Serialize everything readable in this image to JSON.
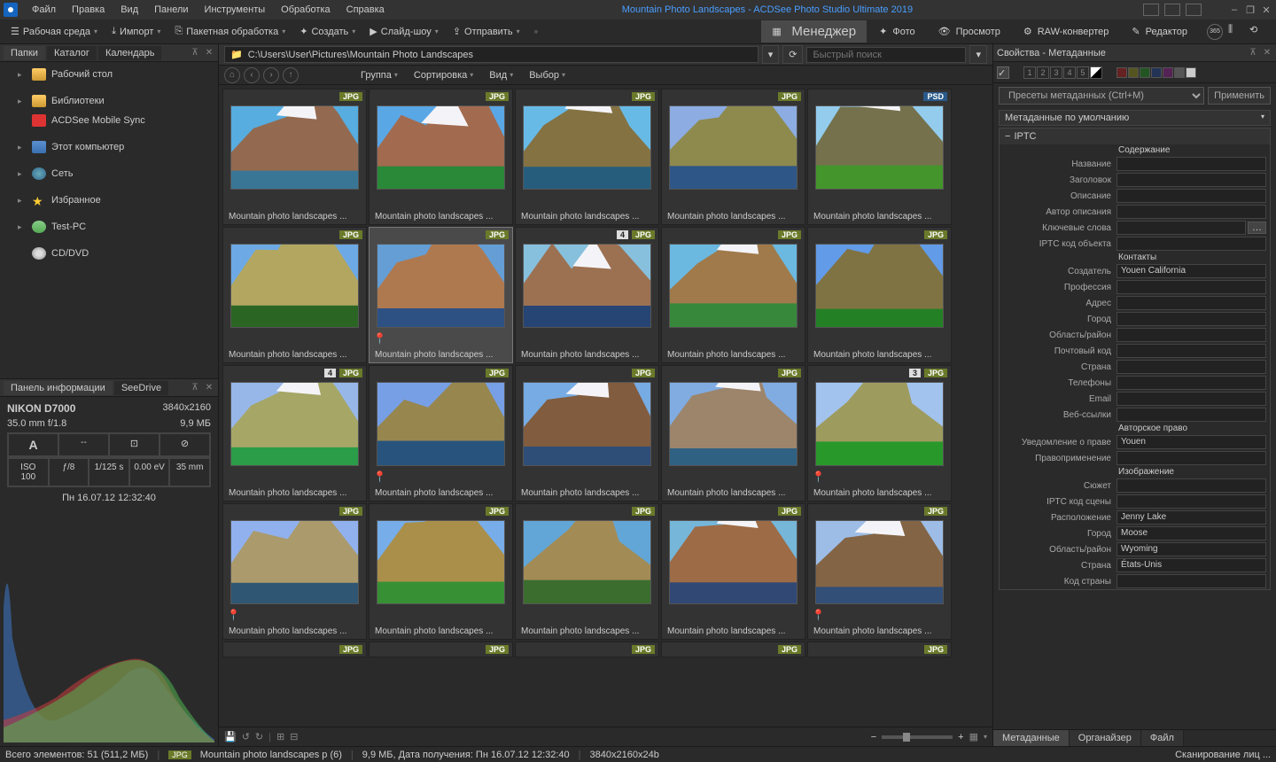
{
  "app": {
    "title": "Mountain Photo Landscapes - ACDSee Photo Studio Ultimate 2019"
  },
  "menu": [
    "Файл",
    "Правка",
    "Вид",
    "Панели",
    "Инструменты",
    "Обработка",
    "Справка"
  ],
  "toolbar": {
    "workspace": "Рабочая среда",
    "import": "Импорт",
    "batch": "Пакетная обработка",
    "create": "Создать",
    "slideshow": "Слайд-шоу",
    "send": "Отправить"
  },
  "modes": {
    "manage": "Менеджер",
    "photo": "Фото",
    "view": "Просмотр",
    "raw": "RAW-конвертер",
    "edit": "Редактор"
  },
  "folders": {
    "tabs": [
      "Папки",
      "Каталог",
      "Календарь"
    ],
    "items": [
      {
        "label": "Рабочий стол",
        "icon": "desktop",
        "exp": true
      },
      {
        "label": "Библиотеки",
        "icon": "lib",
        "exp": true
      },
      {
        "label": "ACDSee Mobile Sync",
        "icon": "mobile",
        "exp": false
      },
      {
        "label": "Этот компьютер",
        "icon": "pc",
        "exp": true
      },
      {
        "label": "Сеть",
        "icon": "net",
        "exp": true
      },
      {
        "label": "Избранное",
        "icon": "star",
        "exp": true
      },
      {
        "label": "Test-PC",
        "icon": "user",
        "exp": true
      },
      {
        "label": "CD/DVD",
        "icon": "cd",
        "exp": false
      }
    ]
  },
  "info": {
    "tabs": [
      "Панель информации",
      "SeeDrive"
    ],
    "camera": "NIKON D7000",
    "dims": "3840x2160",
    "lens": "35.0 mm f/1.8",
    "size": "9,9 МБ",
    "row1": [
      "A",
      "--",
      "⊡",
      "⊘"
    ],
    "row2": [
      "ISO 100",
      "ƒ/8",
      "1/125 s",
      "0.00 eV",
      "35 mm"
    ],
    "date": "Пн 16.07.12 12:32:40"
  },
  "path": {
    "value": "C:\\Users\\User\\Pictures\\Mountain Photo Landscapes",
    "search_ph": "Быстрый поиск"
  },
  "viewbar": {
    "group": "Группа",
    "sort": "Сортировка",
    "view": "Вид",
    "select": "Выбор"
  },
  "thumbs": [
    [
      {
        "t": "JPG",
        "n": null
      },
      {
        "t": "JPG",
        "n": null
      },
      {
        "t": "JPG",
        "n": null
      },
      {
        "t": "JPG",
        "n": null
      },
      {
        "t": "PSD",
        "n": null
      }
    ],
    [
      {
        "t": "JPG",
        "n": null
      },
      {
        "t": "JPG",
        "sel": true,
        "pin": true,
        "n": null
      },
      {
        "t": "JPG",
        "nb": "4",
        "n": null
      },
      {
        "t": "JPG",
        "n": null
      },
      {
        "t": "JPG",
        "n": null
      }
    ],
    [
      {
        "t": "JPG",
        "nb": "4",
        "n": null
      },
      {
        "t": "JPG",
        "pin": true,
        "n": null
      },
      {
        "t": "JPG",
        "n": null
      },
      {
        "t": "JPG",
        "n": null
      },
      {
        "t": "JPG",
        "nb": "3",
        "pin": true,
        "n": null
      }
    ],
    [
      {
        "t": "JPG",
        "pin": true,
        "n": null
      },
      {
        "t": "JPG",
        "n": null
      },
      {
        "t": "JPG",
        "n": null
      },
      {
        "t": "JPG",
        "n": null
      },
      {
        "t": "JPG",
        "pin": true,
        "n": null
      }
    ],
    [
      {
        "t": "JPG",
        "n": null,
        "half": true
      },
      {
        "t": "JPG",
        "n": null,
        "half": true
      },
      {
        "t": "JPG",
        "n": null,
        "half": true
      },
      {
        "t": "JPG",
        "n": null,
        "half": true
      },
      {
        "t": "JPG",
        "n": null,
        "half": true
      }
    ]
  ],
  "thumbname": "Mountain photo landscapes ...",
  "props": {
    "title": "Свойства - Метаданные",
    "preset_ph": "Пресеты метаданных (Ctrl+M)",
    "apply": "Применить",
    "default": "Метаданные по умолчанию",
    "iptc": "IPTC",
    "sections": {
      "content_hdr": "Содержание",
      "contacts_hdr": "Контакты",
      "copyright_hdr": "Авторское право",
      "image_hdr": "Изображение"
    },
    "fields": [
      {
        "l": "Название",
        "v": ""
      },
      {
        "l": "Заголовок",
        "v": ""
      },
      {
        "l": "Описание",
        "v": ""
      },
      {
        "l": "Автор описания",
        "v": ""
      },
      {
        "l": "Ключевые слова",
        "v": "",
        "btn": true
      },
      {
        "l": "IPTC код объекта",
        "v": ""
      }
    ],
    "contacts": [
      {
        "l": "Создатель",
        "v": "Youen California"
      },
      {
        "l": "Профессия",
        "v": ""
      },
      {
        "l": "Адрес",
        "v": ""
      },
      {
        "l": "Город",
        "v": ""
      },
      {
        "l": "Область/район",
        "v": ""
      },
      {
        "l": "Почтовый код",
        "v": ""
      },
      {
        "l": "Страна",
        "v": ""
      },
      {
        "l": "Телефоны",
        "v": ""
      },
      {
        "l": "Email",
        "v": ""
      },
      {
        "l": "Веб-ссылки",
        "v": ""
      }
    ],
    "copyright": [
      {
        "l": "Уведомление о праве",
        "v": "Youen"
      },
      {
        "l": "Правоприменение",
        "v": ""
      }
    ],
    "image": [
      {
        "l": "Сюжет",
        "v": ""
      },
      {
        "l": "IPTC код сцены",
        "v": ""
      },
      {
        "l": "Расположение",
        "v": "Jenny Lake"
      },
      {
        "l": "Город",
        "v": "Moose"
      },
      {
        "l": "Область/район",
        "v": "Wyoming"
      },
      {
        "l": "Страна",
        "v": "États-Unis"
      },
      {
        "l": "Код страны",
        "v": ""
      }
    ],
    "tabs": [
      "Метаданные",
      "Органайзер",
      "Файл"
    ]
  },
  "status": {
    "total": "Всего элементов: 51  (511,2 МБ)",
    "file": "Mountain photo landscapes p (6)",
    "details": "9,9 МБ, Дата получения: Пн 16.07.12 12:32:40",
    "dims": "3840x2160x24b",
    "scan": "Сканирование лиц ..."
  }
}
